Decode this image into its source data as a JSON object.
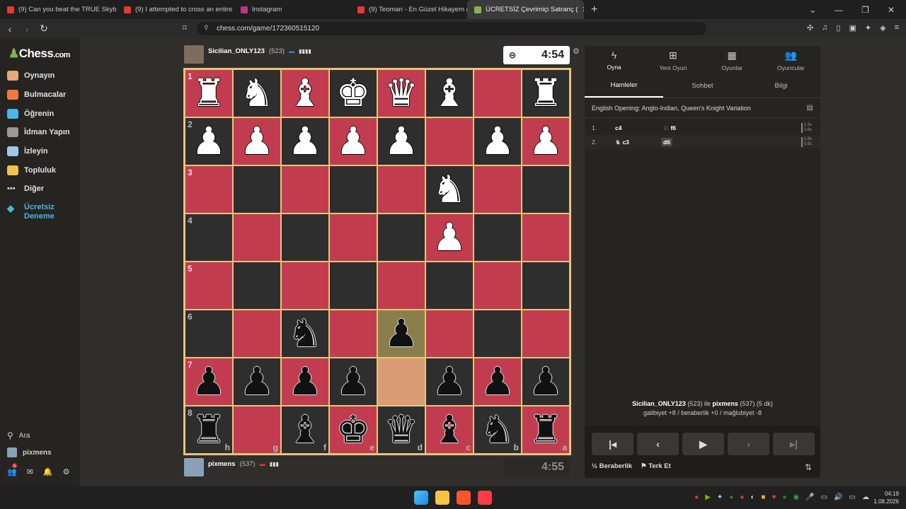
{
  "browser": {
    "tabs": [
      {
        "title": "(9) Can you beat the TRUE Skyblock?",
        "color": "#e53935"
      },
      {
        "title": "(9) I attempted to cross an entire co",
        "color": "#e53935"
      },
      {
        "title": "Instagram",
        "color": "#c13584"
      },
      {
        "title": "(9) Teoman - En Güzel Hikayem (",
        "color": "#e53935"
      },
      {
        "title": "ÜCRETSİZ Çevrimiçi Satranç (",
        "color": "#81b64c"
      }
    ],
    "url": "chess.com/game/172360515120"
  },
  "sidebar": {
    "logo": "Chess",
    "logo_suffix": ".com",
    "items": [
      {
        "label": "Oynayın",
        "icon": "play-icon",
        "color": "#e8a87c"
      },
      {
        "label": "Bulmacalar",
        "icon": "puzzle-icon",
        "color": "#f07a3e"
      },
      {
        "label": "Öğrenin",
        "icon": "learn-icon",
        "color": "#4ab5e6"
      },
      {
        "label": "İdman Yapın",
        "icon": "train-icon",
        "color": "#cccccc"
      },
      {
        "label": "İzleyin",
        "icon": "watch-icon",
        "color": "#9ec7e8"
      },
      {
        "label": "Topluluk",
        "icon": "community-icon",
        "color": "#f2c14e"
      },
      {
        "label": "Diğer",
        "icon": "more-icon",
        "color": "#cccccc"
      }
    ],
    "trial": "Ücretsiz Deneme",
    "search": "Ara",
    "user": "pixmens",
    "notif_count": "1"
  },
  "top_player": {
    "name": "Sicilian_ONLY123",
    "rating": "(523)",
    "clock": "4:54"
  },
  "bottom_player": {
    "name": "pixmens",
    "rating": "(537)",
    "clock": "4:55"
  },
  "board": {
    "ranks": [
      "1",
      "2",
      "3",
      "4",
      "5",
      "6",
      "7",
      "8"
    ],
    "files": [
      "h",
      "g",
      "f",
      "e",
      "d",
      "c",
      "b",
      "a"
    ],
    "rows": [
      [
        "wR",
        "wN",
        "wB",
        "wK",
        "wQ",
        "wB",
        "",
        "wR"
      ],
      [
        "wP",
        "wP",
        "wP",
        "wP",
        "wP",
        "",
        "wP",
        "wP"
      ],
      [
        "",
        "",
        "",
        "",
        "",
        "wN",
        "",
        ""
      ],
      [
        "",
        "",
        "",
        "",
        "",
        "wP",
        "",
        ""
      ],
      [
        "",
        "",
        "",
        "",
        "",
        "",
        "",
        ""
      ],
      [
        "",
        "",
        "bN",
        "",
        "bP",
        "",
        "",
        ""
      ],
      [
        "bP",
        "bP",
        "bP",
        "bP",
        "",
        "bP",
        "bP",
        "bP"
      ],
      [
        "bR",
        "",
        "bB",
        "bK",
        "bQ",
        "bB",
        "bN",
        "bR"
      ]
    ]
  },
  "panel": {
    "tabs": [
      "Oyna",
      "Yeni Oyun",
      "Oyunlar",
      "Oyuncular"
    ],
    "subtabs": [
      "Hamleler",
      "Sohbet",
      "Bilgi"
    ],
    "opening": "English Opening: Anglo-Indian, Queen's Knight Variation",
    "moves": [
      {
        "num": "1.",
        "white": "c4",
        "black": "f6",
        "wt": "2.5s",
        "bt": "3.6s"
      },
      {
        "num": "2.",
        "white": "c3",
        "black": "d6",
        "wt": "1.8s",
        "bt": "0.9s"
      }
    ],
    "summary_line1_a": "Sicilian_ONLY123",
    "summary_line1_b": " (523) ile ",
    "summary_line1_c": "pixmens",
    "summary_line1_d": " (537) (5 dk)",
    "summary_line2": "galibiyet +8 / beraberlik +0 / mağlubiyet -8",
    "draw": "Beraberlik",
    "resign": "Terk Et"
  },
  "taskbar": {
    "time": "04:19",
    "date": "1.08.2026"
  }
}
